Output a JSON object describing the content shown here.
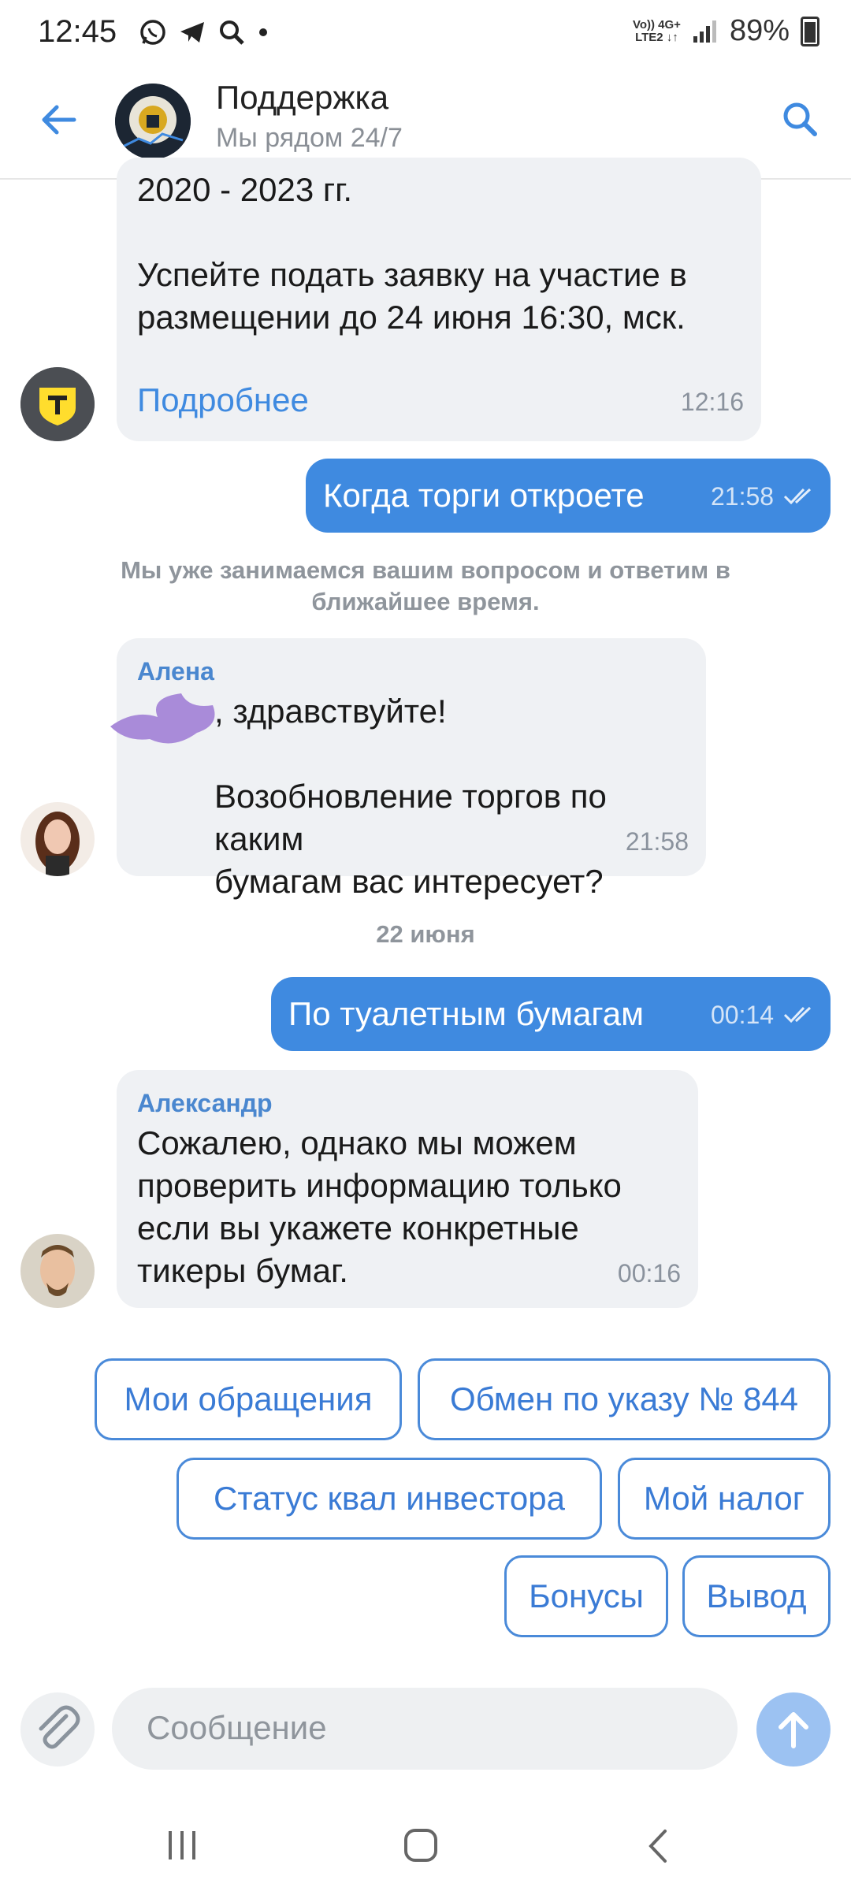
{
  "status_bar": {
    "time": "12:45",
    "network_top": "Vo)) 4G+",
    "network_bottom": "LTE2 ↓↑",
    "battery": "89%"
  },
  "header": {
    "title": "Поддержка",
    "subtitle": "Мы рядом 24/7"
  },
  "messages": {
    "m1": {
      "text": "2020 - 2023 гг.\n\nУспейте подать заявку на участие в\nразмещении до 24 июня 16:30, мск.",
      "link": "Подробнее",
      "time": "12:16"
    },
    "m2": {
      "text": "Когда торги откроете",
      "time": "21:58"
    },
    "system": "Мы уже занимаемся вашим вопросом и ответим в\nближайшее время.",
    "m3": {
      "sender": "Алена",
      "text": ", здравствуйте!\n\nВозобновление торгов по каким\nбумагам вас интересует?",
      "time": "21:58"
    },
    "date_divider": "22 июня",
    "m4": {
      "text": "По туалетным бумагам",
      "time": "00:14"
    },
    "m5": {
      "sender": "Александр",
      "text": "Сожалею, однако мы можем\nпроверить информацию только\nесли вы укажете конкретные\nтикеры бумаг.",
      "time": "00:16"
    }
  },
  "quick_replies": [
    "Мои обращения",
    "Обмен по указу № 844",
    "Статус квал инвестора",
    "Мой налог",
    "Бонусы",
    "Вывод"
  ],
  "composer": {
    "placeholder": "Сообщение"
  },
  "colors": {
    "accent": "#3f8ae0",
    "bubble_in": "#eff1f4",
    "send_disabled": "#9cc2f2"
  }
}
